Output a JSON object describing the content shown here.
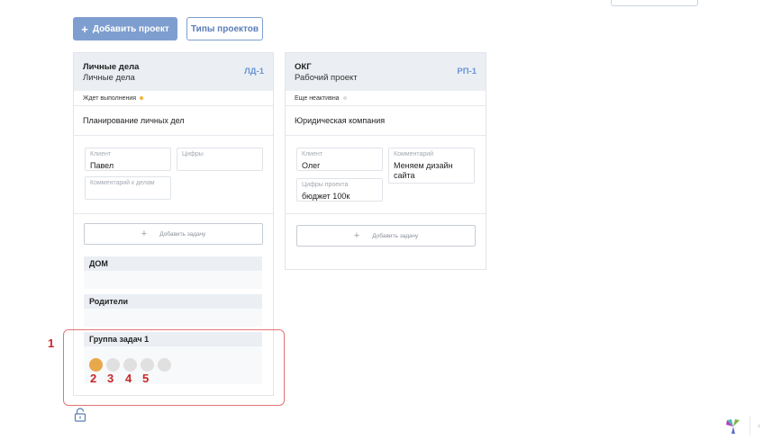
{
  "toolbar": {
    "add_project_label": "Добавить проект",
    "project_types_label": "Типы проектов"
  },
  "projects": [
    {
      "title": "Личные дела",
      "subtitle": "Личные дела",
      "code": "ЛД-1",
      "status": "Ждет выполнения",
      "status_color": "#f0b43c",
      "description": "Планирование личных дел",
      "fields": [
        {
          "label": "Клиент",
          "value": "Павел"
        },
        {
          "label": "Цифры",
          "value": ""
        },
        {
          "label": "Комментарий к делам",
          "value": ""
        }
      ],
      "add_task_label": "Добавить задачу",
      "groups": [
        {
          "name": "ДОМ"
        },
        {
          "name": "Родители"
        },
        {
          "name": "Группа задач 1"
        }
      ]
    },
    {
      "title": "ОКГ",
      "subtitle": "Рабочий проект",
      "code": "РП-1",
      "status": "Еще неактивна",
      "status_color": "#d8dde3",
      "description": "Юридическая компания",
      "fields": [
        {
          "label": "Клиент",
          "value": "Олег"
        },
        {
          "label": "Комментарий",
          "value": "Меняем дизайн сайта"
        },
        {
          "label": "Цифры проекта",
          "value": "бюджет 100к"
        }
      ],
      "add_task_label": "Добавить задачу"
    }
  ],
  "progress_circles": {
    "total": 5,
    "filled": 1,
    "filled_color": "#e8a84c",
    "empty_color": "#e0e0e0"
  },
  "annotations": {
    "box_label": "1",
    "circle_labels": [
      "2",
      "3",
      "4",
      "5"
    ],
    "color": "#c62828"
  }
}
